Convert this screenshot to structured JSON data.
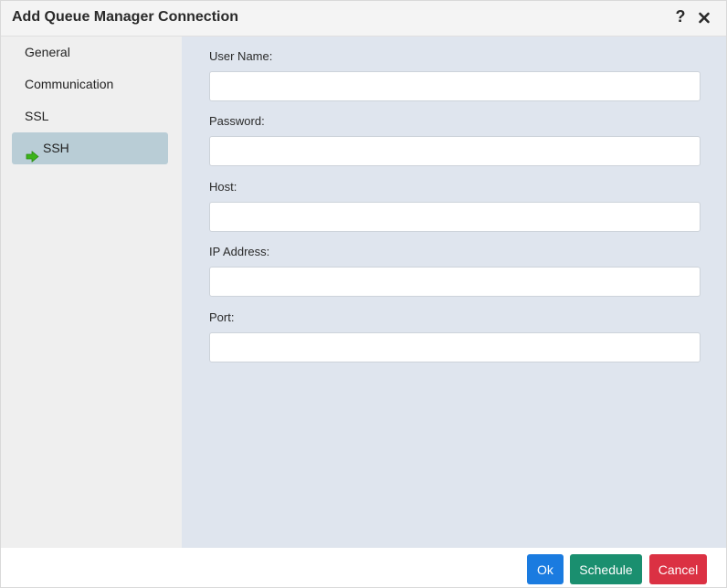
{
  "dialog": {
    "title": "Add Queue Manager Connection",
    "help_label": "?",
    "close_icon": "close-icon"
  },
  "sidebar": {
    "items": [
      {
        "label": "General",
        "active": false
      },
      {
        "label": "Communication",
        "active": false
      },
      {
        "label": "SSL",
        "active": false
      },
      {
        "label": "SSH",
        "active": true,
        "icon": "green-arrow-right-icon"
      }
    ]
  },
  "form": {
    "fields": [
      {
        "label": "User Name:",
        "value": "",
        "placeholder": ""
      },
      {
        "label": "Password:",
        "value": "",
        "placeholder": ""
      },
      {
        "label": "Host:",
        "value": "",
        "placeholder": ""
      },
      {
        "label": "IP Address:",
        "value": "",
        "placeholder": ""
      },
      {
        "label": "Port:",
        "value": "",
        "placeholder": ""
      }
    ]
  },
  "footer": {
    "ok_label": "Ok",
    "schedule_label": "Schedule",
    "cancel_label": "Cancel"
  },
  "colors": {
    "ok": "#1a7be0",
    "schedule": "#1a8f6f",
    "cancel": "#db3143",
    "active_nav": "#b9cdd6",
    "content_bg": "#dfe5ee"
  }
}
